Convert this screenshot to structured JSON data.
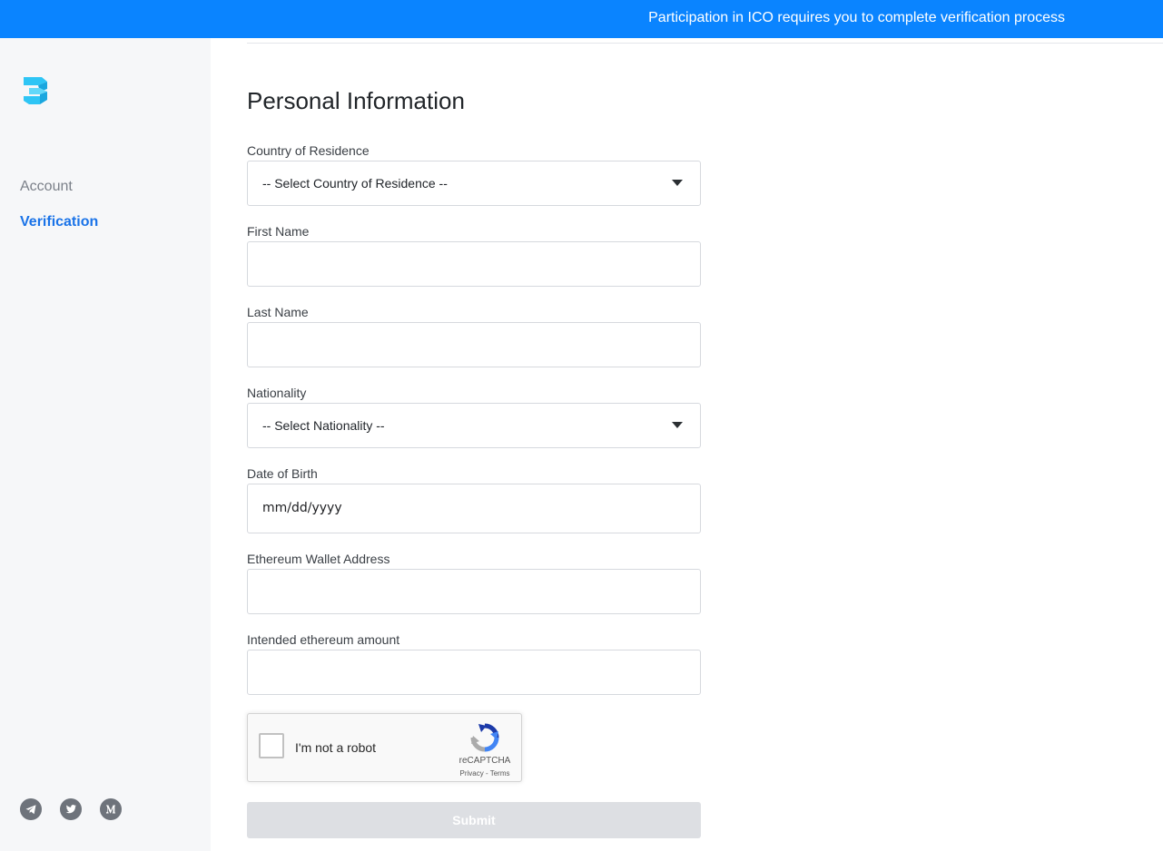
{
  "banner": {
    "message": "Participation in ICO requires you to complete verification process"
  },
  "sidebar": {
    "logo_icon": "brand-3-logo-icon",
    "nav": [
      {
        "label": "Account",
        "active": false
      },
      {
        "label": "Verification",
        "active": true
      }
    ],
    "social_icons": [
      "telegram-icon",
      "twitter-icon",
      "medium-icon"
    ]
  },
  "form": {
    "title": "Personal Information",
    "country": {
      "label": "Country of Residence",
      "value": "-- Select Country of Residence --"
    },
    "first_name": {
      "label": "First Name",
      "value": ""
    },
    "last_name": {
      "label": "Last Name",
      "value": ""
    },
    "nationality": {
      "label": "Nationality",
      "value": "-- Select Nationality --"
    },
    "dob": {
      "label": "Date of Birth",
      "value": "mm/dd/yyyy"
    },
    "wallet": {
      "label": "Ethereum Wallet Address",
      "value": ""
    },
    "amount": {
      "label": "Intended ethereum amount",
      "value": ""
    },
    "captcha": {
      "label": "I'm not a robot",
      "brand": "reCAPTCHA",
      "links": "Privacy - Terms",
      "checked": false
    },
    "submit": {
      "label": "Submit",
      "disabled": true
    }
  },
  "colors": {
    "banner": "#0a84ff",
    "accent": "#1a73e8",
    "sidebar_bg": "#f6f7f9",
    "submit_disabled": "#dddfe3",
    "logo_primary": "#2ec5f5"
  }
}
